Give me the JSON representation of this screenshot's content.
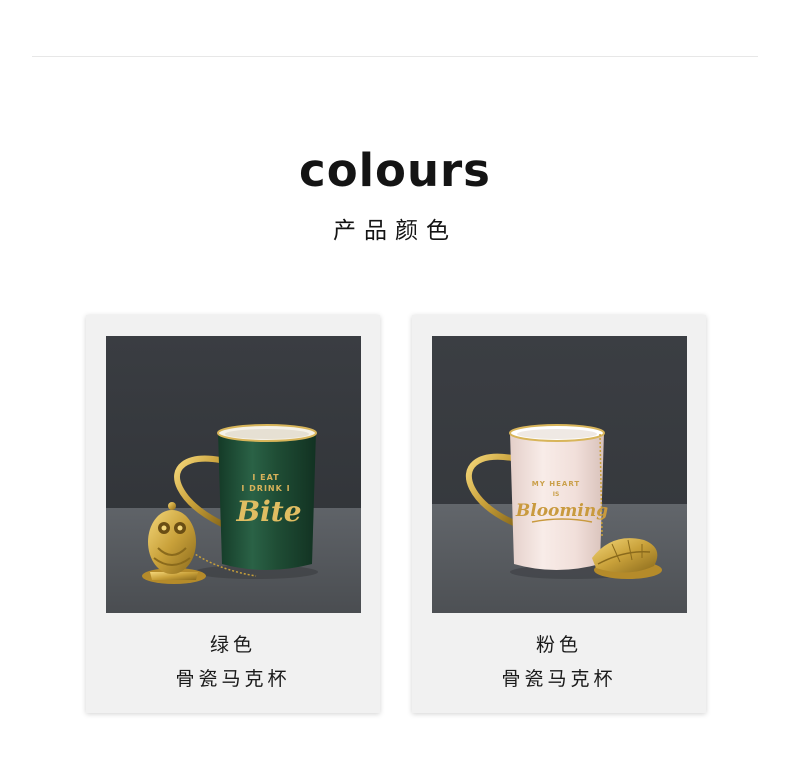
{
  "header": {
    "title": "colours",
    "subtitle": "产品颜色"
  },
  "products": [
    {
      "color_name": "绿色",
      "product_name": "骨瓷马克杯",
      "mug_text": {
        "line1": "I EAT",
        "line2": "I DRINK I",
        "script": "Bite"
      },
      "mug_color": "#1f4d35",
      "accent_color": "#c9a13a"
    },
    {
      "color_name": "粉色",
      "product_name": "骨瓷马克杯",
      "mug_text": {
        "line1": "MY HEART",
        "line2": "IS",
        "script": "Blooming"
      },
      "mug_color": "#f3e3df",
      "accent_color": "#c9a13a"
    }
  ]
}
